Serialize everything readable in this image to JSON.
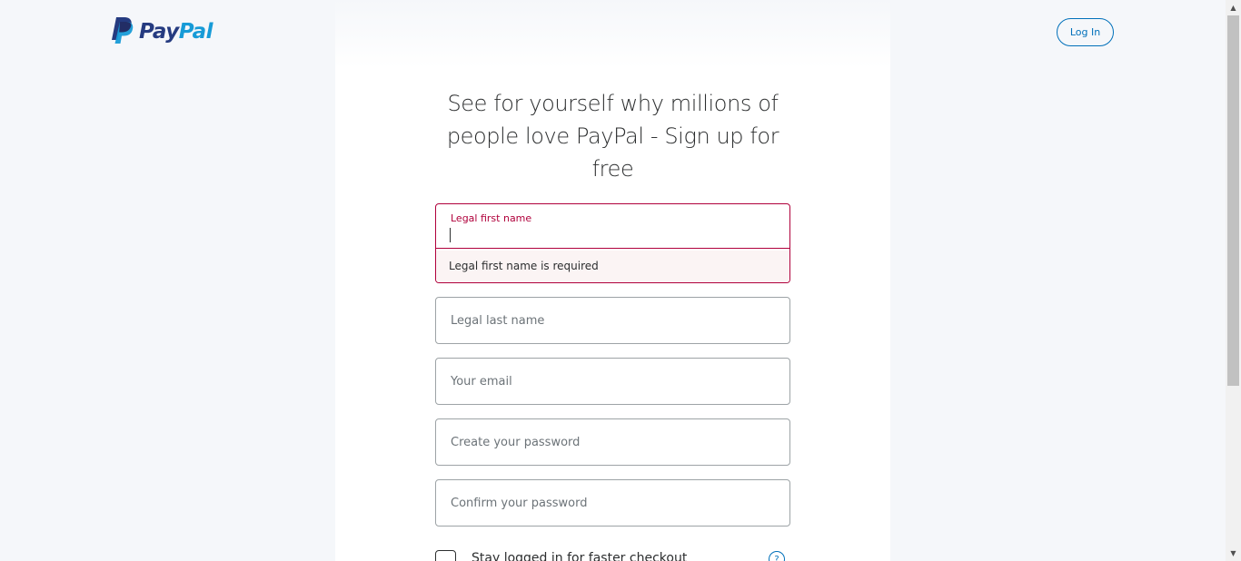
{
  "header": {
    "logo_text_part1": "Pay",
    "logo_text_part2": "Pal",
    "login_label": "Log In"
  },
  "main": {
    "heading": "See for yourself why millions of people love PayPal - Sign up for free",
    "first_name": {
      "label": "Legal first name",
      "value": "",
      "error": "Legal first name is required"
    },
    "last_name_placeholder": "Legal last name",
    "email_placeholder": "Your email",
    "password_placeholder": "Create your password",
    "confirm_password_placeholder": "Confirm your password",
    "stay_logged_in_label": "Stay logged in for faster checkout",
    "help_icon_glyph": "?"
  },
  "colors": {
    "brand_dark": "#253b80",
    "brand_light": "#179bd7",
    "link_blue": "#0070ba",
    "error": "#b0003b"
  },
  "icons": {
    "logo": "paypal-p-logo",
    "help": "help-circle-icon",
    "scroll_up": "arrow-up-icon",
    "scroll_down": "arrow-down-icon"
  }
}
